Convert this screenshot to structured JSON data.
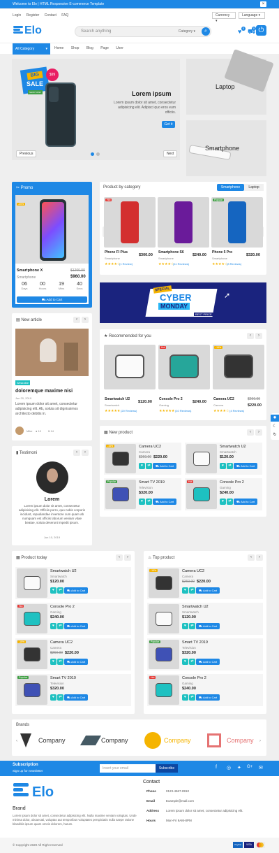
{
  "topbar": {
    "welcome": "Welcome to Elo | HTML Responsive E-commerce Template",
    "close": "×"
  },
  "links": {
    "items": [
      "Login",
      "Register",
      "Contact",
      "FAQ"
    ],
    "currency": "Currency",
    "language": "Language"
  },
  "header": {
    "logo": "Elo",
    "search_placeholder": "Search anything",
    "category": "Category",
    "wishlist_count": "0",
    "cart_count": "0"
  },
  "nav": {
    "all_category": "All Category",
    "items": [
      "Home",
      "Shop",
      "Blog",
      "Page",
      "User"
    ]
  },
  "slider": {
    "badge_big": "BIG",
    "badge_sale": "SALE",
    "badge_price": "$99",
    "badge_shop": "SHOP NOW",
    "title": "Lorem ipsum",
    "text": "Lorem ipsum dolor sit amet, consectetur adipisicing elit. Adipisci quo eros eum officiis.",
    "button": "Get it",
    "prev": "Previous",
    "next": "Next"
  },
  "banners": {
    "laptop": "Laptop",
    "smartphone": "Smartphone"
  },
  "promo": {
    "title": "Promo",
    "tag": "-20%",
    "name": "Smartphone X",
    "old_price": "$1200.00",
    "category": "Smartphone",
    "price": "$960.00",
    "countdown": [
      {
        "v": "06",
        "l": "Days"
      },
      {
        "v": "00",
        "l": "Hours"
      },
      {
        "v": "19",
        "l": "Mins"
      },
      {
        "v": "40",
        "l": "Secs"
      }
    ],
    "button": "Add to Cart"
  },
  "bycat": {
    "title": "Product by category",
    "tab1": "Smartphone",
    "tab2": "Laptop",
    "items": [
      {
        "tag": "Hot",
        "name": "Phone FI Plus",
        "price": "$300.00",
        "cat": "Smartphone",
        "stars": "★★★★☆",
        "reviews": "(1 Review)"
      },
      {
        "tag": "",
        "name": "Smartphone S6",
        "price": "$240.00",
        "cat": "Smartphone",
        "stars": "★★★★☆",
        "reviews": "(11 Reviews)"
      },
      {
        "tag": "Popular",
        "name": "Phone 5 Pro",
        "price": "$320.00",
        "cat": "Smartphone",
        "stars": "★★★★☆",
        "reviews": "(8 Reviews)"
      }
    ]
  },
  "cyber": {
    "special": "SPECIAL",
    "cyber": "CYBER",
    "monday": "MONDAY",
    "best": "BEST PRICE"
  },
  "article": {
    "title": "New article",
    "tag": "Wearable",
    "heading": "doloremque maxime nisi",
    "date": "Jun 20, 2019",
    "text": "Lorem ipsum dolor sit amet, consectetur adipisicing elit. Ab, soluta sit dignissimos architecto debitis in.",
    "author": "Mike",
    "comments": "10",
    "likes": "14"
  },
  "recommended": {
    "title": "Recommended for you",
    "items": [
      {
        "tag": "",
        "name": "Smartwatch U2",
        "price": "$120.00",
        "cat": "Smartwatch",
        "stars": "★★★★★",
        "reviews": "(20 Reviews)"
      },
      {
        "tag": "Hot",
        "name": "Console Pro 2",
        "price": "$240.00",
        "cat": "Gaming",
        "stars": "★★★★★",
        "reviews": "(10 Reviews)"
      },
      {
        "tag": "-15%",
        "name": "Camera UC2",
        "old": "$260.00",
        "price": "$220.00",
        "cat": "Camera",
        "stars": "★★★★☆",
        "reviews": "(4 Reviews)"
      }
    ]
  },
  "newproduct": {
    "title": "New product",
    "items": [
      {
        "tag": "-15%",
        "name": "Camera UC2",
        "cat": "Camera",
        "old": "$260.00",
        "price": "$220.00"
      },
      {
        "tag": "",
        "name": "Smartwatch U2",
        "cat": "Smartwatch",
        "old": "",
        "price": "$120.00"
      },
      {
        "tag": "Popular",
        "name": "Smart TV 2019",
        "cat": "Television",
        "old": "",
        "price": "$320.00"
      },
      {
        "tag": "Hot",
        "name": "Console Pro 2",
        "cat": "Gaming",
        "old": "",
        "price": "$240.00"
      }
    ],
    "cart": "Add to Cart"
  },
  "testimonial": {
    "title": "Testimoni",
    "name": "Lorem",
    "text": "Lorem ipsum dolor sit amet, consectetur adipisicing elit. Officiis porro, quo nobis corporis incidunt, repudiandae inventore cum quam ab numquam est officiis laborum veniam vitae beatae, soluta deserunt impedit ipsum.",
    "date": "Jun 10, 2019"
  },
  "today": {
    "title": "Product today",
    "items": [
      {
        "tag": "",
        "name": "Smartwatch U2",
        "cat": "Smartwatch",
        "old": "",
        "price": "$120.00"
      },
      {
        "tag": "Hot",
        "name": "Console Pro 2",
        "cat": "Gaming",
        "old": "",
        "price": "$240.00"
      },
      {
        "tag": "-15%",
        "name": "Camera UC2",
        "cat": "Camera",
        "old": "$260.00",
        "price": "$220.00"
      },
      {
        "tag": "Popular",
        "name": "Smart TV 2019",
        "cat": "Television",
        "old": "",
        "price": "$320.00"
      }
    ]
  },
  "top": {
    "title": "Top product",
    "items": [
      {
        "tag": "-15%",
        "name": "Camera UC2",
        "cat": "Camera",
        "old": "$260.00",
        "price": "$220.00"
      },
      {
        "tag": "",
        "name": "Smartwatch U2",
        "cat": "Smartwatch",
        "old": "",
        "price": "$120.00"
      },
      {
        "tag": "Popular",
        "name": "Smart TV 2019",
        "cat": "Television",
        "old": "",
        "price": "$320.00"
      },
      {
        "tag": "Hot",
        "name": "Console Pro 2",
        "cat": "Gaming",
        "old": "",
        "price": "$240.00"
      }
    ]
  },
  "brands": {
    "title": "Brands",
    "name": "Company"
  },
  "subscription": {
    "title": "Subscription",
    "sub": "Sign up for newsletter",
    "placeholder": "Insert your email",
    "button": "Subscribe"
  },
  "footer": {
    "brand": "Brand",
    "text": "Lorem ipsum dolor sit amet, consectetur adipisicing elit. Nulla maxime veniam voluptas. Unde minima dolor, obcaecati, voluptas aut temporibus voluptates perspiciatis nulla saepe ratione blanditiis ipsum quam omnis dolorem, harum.",
    "contact": "Contact",
    "rows": [
      {
        "k": "Phone",
        "v": "0123-4567-8910"
      },
      {
        "k": "Email",
        "v": "Example@mail.com"
      },
      {
        "k": "Address",
        "v": "Lorem ipsum dolor sit amet, consectetur adipisicing elit."
      },
      {
        "k": "Hours",
        "v": "Mon-Fri 9AM-8PM"
      }
    ],
    "copyright": "© Copyright 2020 All Right reserved",
    "pay": [
      "PayPal",
      "VISA",
      ""
    ]
  },
  "colors": {
    "accent": "#1e88e5",
    "teal": "#1ec1c1",
    "hot": "#e53935",
    "sale": "#f5b400",
    "popular": "#43a047"
  }
}
